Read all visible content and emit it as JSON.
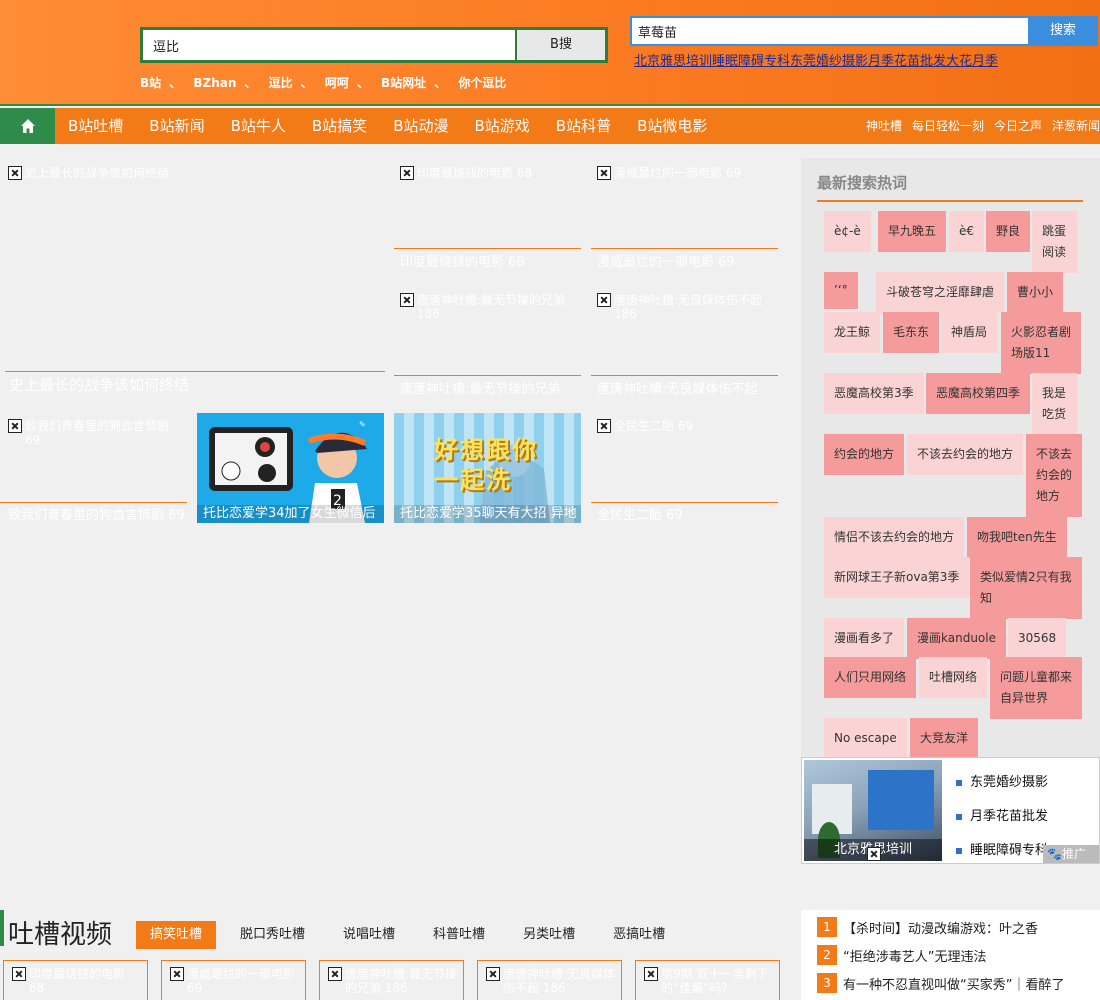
{
  "search_main": {
    "value": "逗比",
    "button": "B搜"
  },
  "hotwords": [
    "B站",
    "BZhan",
    "逗比",
    "呵呵",
    "B站网址",
    "你个逗比"
  ],
  "hotword_sep": "、",
  "search_ad": {
    "value": "草莓苗",
    "button": "搜索"
  },
  "ad_links": "北京雅思培训睡眠障碍专科东莞婚纱摄影月季花苗批发大花月季",
  "nav": {
    "main": [
      "B站吐槽",
      "B站新闻",
      "B站牛人",
      "B站搞笑",
      "B站动漫",
      "B站游戏",
      "B站科普",
      "B站微电影"
    ],
    "right": [
      "神吐槽",
      "每日轻松一刻",
      "今日之声",
      "洋葱新闻"
    ]
  },
  "tiles": {
    "big": {
      "alt": "史上最长的战争该如何终结",
      "caption": "史上最长的战争该如何终结"
    },
    "t1": {
      "alt": "印度最烧钱的电影 68",
      "caption": "印度最烧钱的电影 68"
    },
    "t2": {
      "alt": "漫威最烂的一部电影 69",
      "caption": "漫威最烂的一部电影 69"
    },
    "t3": {
      "alt": "唐唐神吐槽:最无节操的兄弟 186",
      "caption": "唐唐神吐槽:最无节操的兄弟"
    },
    "t4": {
      "alt": "唐唐神吐槽:无良媒体伤不起 186",
      "caption": "唐唐神吐槽:无良媒体伤不起"
    },
    "t5": {
      "alt": "致我们青春里的狗血言情剧 69",
      "caption": "致我们青春里的狗血言情剧 69"
    },
    "t6": {
      "caption": "托比恋爱学34加了女生微信后"
    },
    "t7": {
      "caption": "托比恋爱学35聊天有大招 异地",
      "overlay": "好想跟你一起洗"
    },
    "t8": {
      "alt": "全民生二胎 69",
      "caption": "全民生二胎 69"
    }
  },
  "sidebar": {
    "title": "最新搜索热词",
    "tags": [
      "è¢-è",
      "早九晚五",
      "è€",
      "野良",
      "跳蛋阅读",
      "’‘°",
      "斗破苍穹之淫靡肆虐",
      "曹小小",
      "龙王鲸",
      "毛东东",
      "神盾局",
      "火影忍者剧场版11",
      "恶魔高校第3季",
      "恶魔高校第四季",
      "我是吃货",
      "约会的地方",
      "不该去约会的地方",
      "不该去约会的地方",
      "情侣不该去约会的地方",
      "吻我吧ten先生",
      "新网球王子新ova第3季",
      "类似爱情2只有我知",
      "漫画看多了",
      "漫画kanduole",
      "30568",
      "人们只用网络",
      "吐槽网络",
      "问题儿童都来自异世界",
      "No escape",
      "大竞友洋"
    ]
  },
  "promo": {
    "image_caption": "北京雅思培训",
    "links": [
      "东莞婚纱摄影",
      "月季花苗批发",
      "睡眠障碍专科"
    ],
    "badge": "推广"
  },
  "section": {
    "title": "吐槽视频",
    "tabs": [
      "搞笑吐槽",
      "脱口秀吐槽",
      "说唱吐槽",
      "科普吐槽",
      "另类吐槽",
      "恶搞吐槽"
    ],
    "cards": [
      "印度最烧钱的电影 68",
      "漫威最烂的一部电影 69",
      "唐唐神吐槽:最无节操的兄弟 186",
      "唐唐神吐槽:无良媒体伤不起 186",
      "第9期 双十一卖剩下的“佳偏”吗?"
    ]
  },
  "news": [
    {
      "num": "1",
      "text": "【杀时间】动漫改编游戏：叶之香"
    },
    {
      "num": "2",
      "text": "“拒绝涉毒艺人”无理违法"
    },
    {
      "num": "3",
      "text": "有一种不忍直视叫做“买家秀”｜看醉了"
    }
  ],
  "colors": {
    "orange": "#f27a17",
    "green": "#2e8b4a",
    "tag_light": "#fad4d4",
    "tag_dark": "#f59b9b",
    "link_blue": "#1c2a9c"
  }
}
